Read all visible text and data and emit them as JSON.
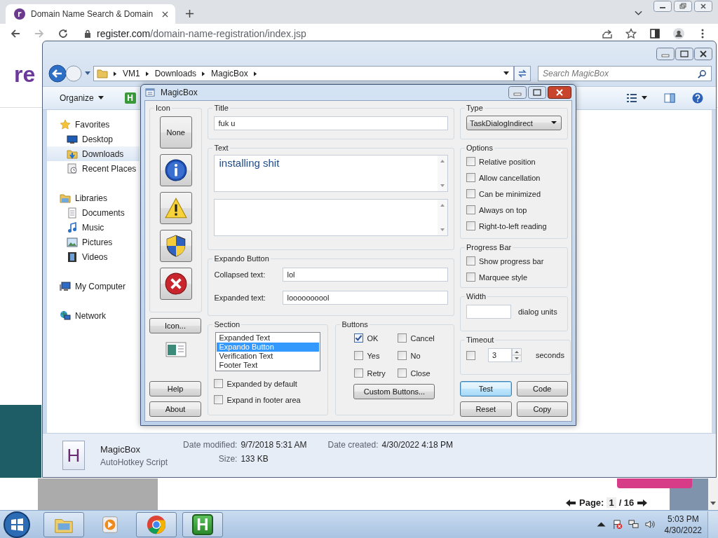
{
  "browser": {
    "tab_title": "Domain Name Search & Domain",
    "url_host": "register.com",
    "url_path": "/domain-name-registration/index.jsp"
  },
  "webpage": {
    "logo": "re",
    "pager": {
      "label": "Page:",
      "current": "1",
      "total": "/ 16"
    }
  },
  "explorer": {
    "breadcrumb": [
      "VM1",
      "Downloads",
      "MagicBox"
    ],
    "search": {
      "placeholder": "Search MagicBox"
    },
    "toolbar": {
      "organize": "Organize",
      "app_letter": "H"
    },
    "nav": [
      {
        "label": "Favorites",
        "kind": "favorites",
        "selected": false,
        "children": [
          {
            "label": "Desktop",
            "kind": "desktop",
            "selected": false
          },
          {
            "label": "Downloads",
            "kind": "downloads",
            "selected": true
          },
          {
            "label": "Recent Places",
            "kind": "recent",
            "selected": false
          }
        ]
      },
      {
        "label": "Libraries",
        "kind": "libraries",
        "selected": false,
        "children": [
          {
            "label": "Documents",
            "kind": "documents",
            "selected": false
          },
          {
            "label": "Music",
            "kind": "music",
            "selected": false
          },
          {
            "label": "Pictures",
            "kind": "pictures",
            "selected": false
          },
          {
            "label": "Videos",
            "kind": "videos",
            "selected": false
          }
        ]
      },
      {
        "label": "My Computer",
        "kind": "computer",
        "selected": false
      },
      {
        "label": "Network",
        "kind": "network",
        "selected": false
      }
    ],
    "details": {
      "icon_letter": "H",
      "name": "MagicBox",
      "type": "AutoHotkey Script",
      "modified": {
        "label": "Date modified:",
        "value": "9/7/2018 5:31 AM"
      },
      "size": {
        "label": "Size:",
        "value": "133 KB"
      },
      "created": {
        "label": "Date created:",
        "value": "4/30/2022 4:18 PM"
      }
    }
  },
  "dialog": {
    "title": "MagicBox",
    "icon_group": {
      "label": "Icon",
      "buttons": [
        {
          "kind": "none",
          "label": "None"
        },
        {
          "kind": "info"
        },
        {
          "kind": "warning"
        },
        {
          "kind": "shield"
        },
        {
          "kind": "error"
        }
      ],
      "icon_button": "Icon...",
      "help": "Help",
      "about": "About"
    },
    "title_group": {
      "label": "Title",
      "value": "fuk u"
    },
    "text_group": {
      "label": "Text",
      "value": "installing shit"
    },
    "expando": {
      "label": "Expando Button",
      "collapsed_label": "Collapsed text:",
      "collapsed": "lol",
      "expanded_label": "Expanded text:",
      "expanded": "loooooooool"
    },
    "section": {
      "label": "Section",
      "items": [
        {
          "label": "Expanded Text",
          "selected": false
        },
        {
          "label": "Expando Button",
          "selected": true
        },
        {
          "label": "Verification Text",
          "selected": false
        },
        {
          "label": "Footer Text",
          "selected": false
        }
      ],
      "checks": [
        {
          "label": "Expanded by default",
          "checked": false
        },
        {
          "label": "Expand in footer area",
          "checked": false
        }
      ]
    },
    "buttons_group": {
      "label": "Buttons",
      "checks": [
        {
          "label": "OK",
          "checked": true
        },
        {
          "label": "Cancel",
          "checked": false
        },
        {
          "label": "Yes",
          "checked": false
        },
        {
          "label": "No",
          "checked": false
        },
        {
          "label": "Retry",
          "checked": false
        },
        {
          "label": "Close",
          "checked": false
        }
      ],
      "custom": "Custom Buttons..."
    },
    "type": {
      "label": "Type",
      "value": "TaskDialogIndirect"
    },
    "options": {
      "label": "Options",
      "checks": [
        {
          "label": "Relative position",
          "checked": false
        },
        {
          "label": "Allow cancellation",
          "checked": false
        },
        {
          "label": "Can be minimized",
          "checked": false
        },
        {
          "label": "Always on top",
          "checked": false
        },
        {
          "label": "Right-to-left reading",
          "checked": false
        }
      ]
    },
    "progress": {
      "label": "Progress Bar",
      "checks": [
        {
          "label": "Show progress bar",
          "checked": false
        },
        {
          "label": "Marquee style",
          "checked": false
        }
      ]
    },
    "width": {
      "label": "Width",
      "unit": "dialog units"
    },
    "timeout": {
      "label": "Timeout",
      "checked": false,
      "value": "3",
      "unit": "seconds"
    },
    "actions": [
      {
        "label": "Test",
        "default": true
      },
      {
        "label": "Code",
        "default": false
      },
      {
        "label": "Reset",
        "default": false
      },
      {
        "label": "Copy",
        "default": false
      }
    ]
  },
  "taskbar": {
    "apps": [
      {
        "kind": "explorer",
        "active": true
      },
      {
        "kind": "media",
        "active": false
      },
      {
        "kind": "chrome",
        "active": true
      },
      {
        "kind": "ahk",
        "active": true,
        "letter": "H"
      }
    ],
    "time": "5:03 PM",
    "date": "4/30/2022"
  }
}
